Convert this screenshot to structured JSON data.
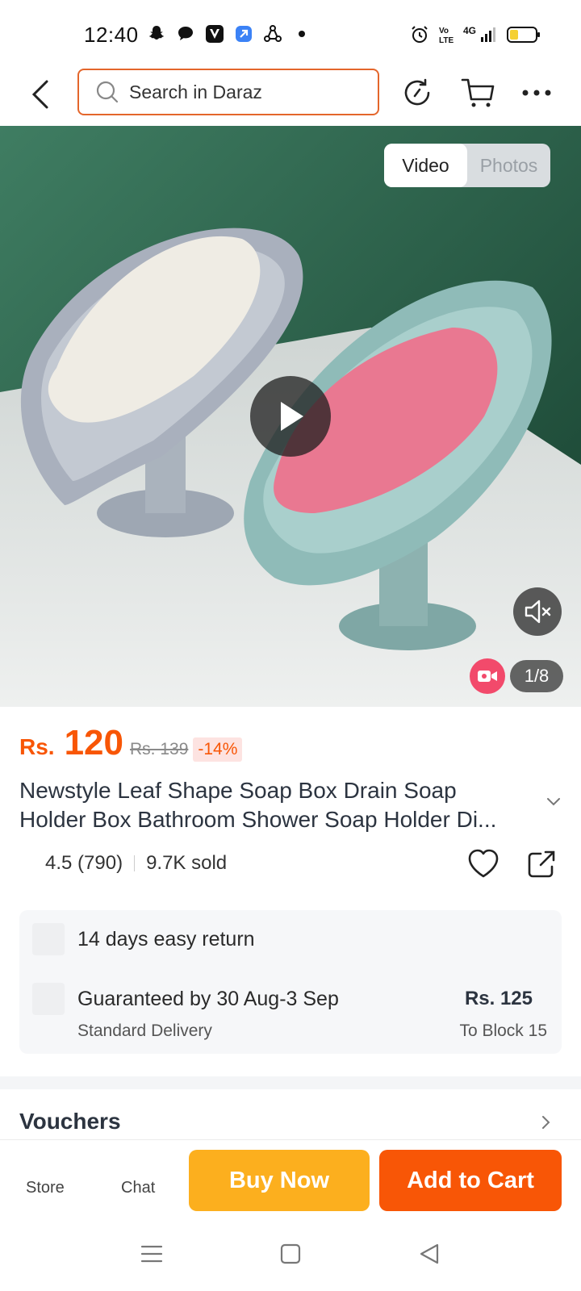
{
  "status_bar": {
    "time": "12:40",
    "left_icons": [
      "snapchat-icon",
      "chat-bubble-icon",
      "v-app-icon",
      "blue-app-icon",
      "share-network-icon",
      "dot-icon"
    ],
    "right_icons": [
      "alarm-icon",
      "volte-icon",
      "signal-4g-icon",
      "battery-icon"
    ],
    "network_label": "4G",
    "volte_label": "Vo LTE"
  },
  "header": {
    "search_placeholder": "Search in Daraz",
    "icons": [
      "back-icon",
      "search-icon",
      "history-icon",
      "cart-icon",
      "more-icon"
    ]
  },
  "media": {
    "tabs": [
      {
        "label": "Video",
        "active": true
      },
      {
        "label": "Photos",
        "active": false
      }
    ],
    "counter": "1/8",
    "icons": [
      "play-icon",
      "mute-icon",
      "video-badge-icon"
    ]
  },
  "product": {
    "currency": "Rs.",
    "price": "120",
    "old_price": "Rs. 139",
    "discount": "-14%",
    "title_line1": "Newstyle Leaf Shape Soap Box Drain Soap",
    "title_line2": "Holder Box Bathroom Shower Soap Holder Di...",
    "rating": "4.5 (790)",
    "sold": "9.7K sold"
  },
  "service": {
    "return_text": "14 days easy return",
    "delivery_text": "Guaranteed by 30 Aug-3 Sep",
    "delivery_sub": "Standard Delivery",
    "delivery_fee": "Rs. 125",
    "destination": "To Block 15"
  },
  "vouchers": {
    "label": "Vouchers"
  },
  "bottom_bar": {
    "store": "Store",
    "chat": "Chat",
    "buy_now": "Buy Now",
    "add_to_cart": "Add to Cart"
  },
  "nav_bar": {
    "icons": [
      "menu-icon",
      "home-square-icon",
      "back-triangle-icon"
    ]
  },
  "colors": {
    "accent": "#f85606",
    "buy_now": "#fcaf1e",
    "search_border": "#e4662b"
  }
}
